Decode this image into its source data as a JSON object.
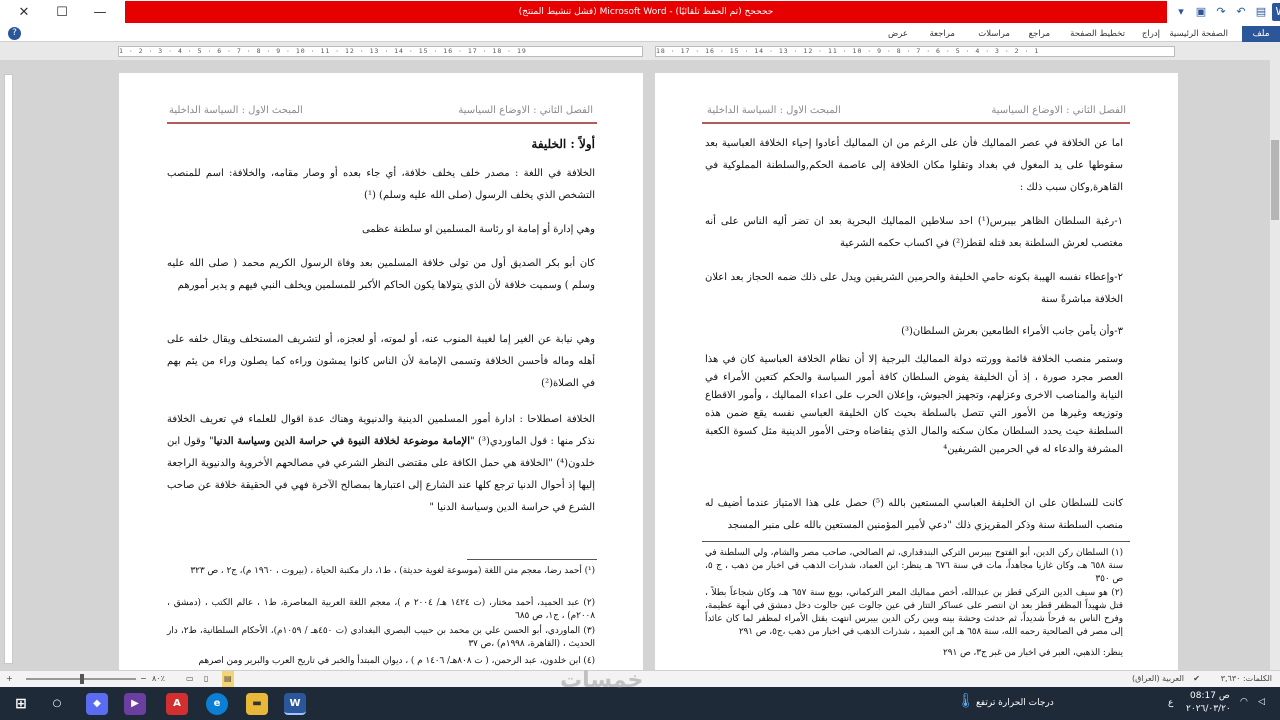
{
  "window": {
    "title": "ححححح (تم الحفظ تلقائيًا) - Microsoft Word (فشل تنشيط المنتج)",
    "close": "✕",
    "maximize": "☐",
    "minimize": "—"
  },
  "ribbon": {
    "tabs": [
      "ملف",
      "الصفحة الرئيسية",
      "إدراج",
      "تخطيط الصفحة",
      "مراجع",
      "مراسلات",
      "مراجعة",
      "عرض"
    ],
    "help": "?"
  },
  "ruler": {
    "top_left": "1 · 2 · 3 · 4 · 5 · 6 · 7 · 8 · 9 · 10 · 11 · 12 · 13 · 14 · 15 · 16 · 17 · 18 · 19",
    "top_right": "18 · 17 · 16 · 15 · 14 · 13 · 12 · 11 · 10 · 9 · 8 · 7 · 6 · 5 · 4 · 3 · 2 · 1"
  },
  "right_page": {
    "header_right": "الفصل الثاني : الاوضاع السياسية",
    "header_left": "المبحث الاول : السياسة الداخلية",
    "p1": "اما عن الخلافة في عصر المماليك فأن على الرغم من ان المماليك أعادوا إحياء الخلافة العباسية بعد سقوطها على يد المغول في بغداد وتقلوا مكان الخلافة إلى عاصمة الحكم,والسلطنة المملوكية في القاهرة,وكان سبب ذلك :",
    "p2": "١-رغبة السلطان الظاهر بيبرس(¹) احد سلاطين المماليك البحرية بعد ان تضر أليه الناس على أنه مغتصب لعرش السلطنة بعد قتله لقطز(²) في اكساب حكمه الشرعية",
    "p3": "٢-وإعطاء نفسه الهيبة بكونه حامي الخليفة والحرمين الشريفين ويدل على ذلك ضمه الحجاز بعد اعلان الخلافة مباشرةً سنة",
    "p4": "٣-وأن يأمن جانب الأمراء الطامعين بعرش السلطان(³)",
    "p5": "وستمر منصب الخلافة قائمة وورثته دولة المماليك البرجية إلا أن نظام الخلافة العباسية كان في هذا العصر مجرد صورة ، إذ أن الخليفة يفوض السلطان كافة أمور السياسة والحكم كتعين الأمراء في النيابة والمناصب الاخرى وعزلهم، وتجهيز الجيوش، وإعلان الحرب على اعداء المماليك ، وأمور الاقطاع وتوزيعه وغيرها من الأمور التي تتصل بالسلطة بحيث كان الخليفة العباسي نفسه يقع ضمن هذه السلطنة حيث يحدد السلطان مكان سكنه والمال الذي يتقاضاه وحتى الأمور الدينية مثل كسوة الكعبة المشرفة والدعاء له في الحرمين الشريفين⁴",
    "p6": "كانت للسلطان على ان الخليفة العباسي المستعين بالله (⁵) حصل على هذا الامتياز عندما أضيف له منصب السلطنة سنة وذكر المقريزي ذلك \"دعي لأمير المؤمنين المستعين بالله على منبر المسجد",
    "fn1": "(١) السلطان ركن الدين، أبو الفتوح بيبرس التركي البندقداري، ثم الصالحي، صاحب مصر والشام، ولي السلطنة في سنة ٦٥٨ هـ، وكان غازيا مجاهداً، مات في سنة ٦٧٦ هـ ينظر: ابن العماد، شذرات الذهب في اخبار من ذهب ، ج ٥، ص ٣٥٠",
    "fn2": "(٢) هو سيف الدين التركي قطز بن عبدالله، أخص مماليك المعز التركماني، بويع سنة ٦٥٧ هـ، وكان شجاعاً بطلاً ، قتل شهيداً المظفر قطز بعد ان انتصر على عساكر التتار في عين جالوت عين جالوت دخل دمشق في أبهة عظيمة، وفرح الناس به فرحاً شديداً، ثم حدثت وحشة بينه وبين ركن الدين بيبرس انتهت بقتل الأمراء لمظفر لما كان عائداً إلى مصر في الصالحية رحمه الله، سنة ٦٥٨ هـ ابن العميد ، شذرات الذهب في اخبار من ذهب ،ج٥، ص ٢٩١",
    "fn3": "ينظر: الذهبي، العبر في اخبار من غبر ج٣، ص ٢٩١"
  },
  "left_page": {
    "header_right": "الفصل الثاني : الاوضاع السياسية",
    "header_left": "المبحث الاول : السياسة الداخلية",
    "heading": "أولاً : الخليفة",
    "p1": "الخلافة في اللغة : مصدر خلف يخلف خلافة، أي جاء بعده أو وصار مقامه، والخلافة: اسم للمنصب التشخص الذي يخلف الرسول (صلى الله عليه وسلم) (¹)",
    "p2": "وهي إدارة أو إمامة او رئاسة المسلمين او سلطنة عظمى",
    "p3": "كان أبو بكر الصديق أول من تولى خلافة المسلمين بعد وفاة الرسول الكريم محمد ( صلى الله عليه وسلم ) وسميت خلافة لأن الذي يتولاها يكون الحاكم الأكبر للمسلمين ويخلف النبي فيهم و يدير أمورهم",
    "p4": "وهي نيابة عن الغير إما لغيبة المنوب عنه، أو لموته، أو لعجزه، أو لتشريف المستخلف ويقال خلفه على أهله وماله فأحسن الخلافة وتسمى الإمامة لأن الناس كانوا يمشون وراءه كما يصلون وراء من يئم بهم في الصلاة(²)",
    "p5a": "الخلافة اصطلاحا : ادارة أمور المسلمين الدينية والدنيوية وهناك عدة اقوال للعلماء في تعريف الخلافة نذكر منها : قول الماوردي(³) \"",
    "p5b": "الإمامة موضوعة لخلافة النبوة في حراسة الدين وسياسة الدنيا",
    "p5c": "\" وقول ابن خلدون(⁴) \"الخلافة هي حمل الكافة على مقتضى النظر الشرعي في مصالحهم الأخروية والدنيوية الراجعة إليها إذ أحوال الدنيا ترجع كلها عند الشارع إلى اعتبارها بمصالح الآخرة فهي في الحقيقة خلافة عن صاحب الشرع في حراسة الدين وسياسة الدنيا \"",
    "fn1": "(¹) أحمد رضا، معجم متن اللغة (موسوعة لغوية حديثة) ، ط١، دار مكتبة الحياة ، (بيروت ، ١٩٦٠ م)، ج٢ ، ص ٣٢٣",
    "fn2": "(٢) عبد الحميد، أحمد مختار، (ت ١٤٢٤ هـ/ ٢٠٠٤ م )، معجم اللغة العربية المعاصرة، ط١ ، عالم الكتب ، (دمشق ، ٢٠٠٨م) ، ج١، ص ٦٨٥",
    "fn3": "(٣) الماوردي، أبو الحسن علي بن محمد بن حبيب البصري البغدادي (ت ٤٥٠هـ / ١٠٥٩م)، الأحكام السلطانية، ط٢، دار الحديث ، (القاهرة، ١٩٩٨م) ،ص ٣٧",
    "fn4": "(٤) ابن خلدون، عبد الرحمن، ( ت ٨٠٨هـ/ ١٤٠٦ م ) ، ديوان المبتدأ والخبر في تاريخ العرب والبربر ومن اصرهم"
  },
  "status": {
    "words": "الكلمات: ٣,٦٣٠",
    "language": "العربية (العراق)",
    "zoom": "٨٠٪"
  },
  "taskbar": {
    "weather": "درجات الحرارة ترتفع",
    "time": "08:17 ص",
    "date": "٢٠٢٦/٠٣/٢٠",
    "lang": "ع",
    "apps": [
      "W"
    ]
  },
  "watermark": "خمسات"
}
